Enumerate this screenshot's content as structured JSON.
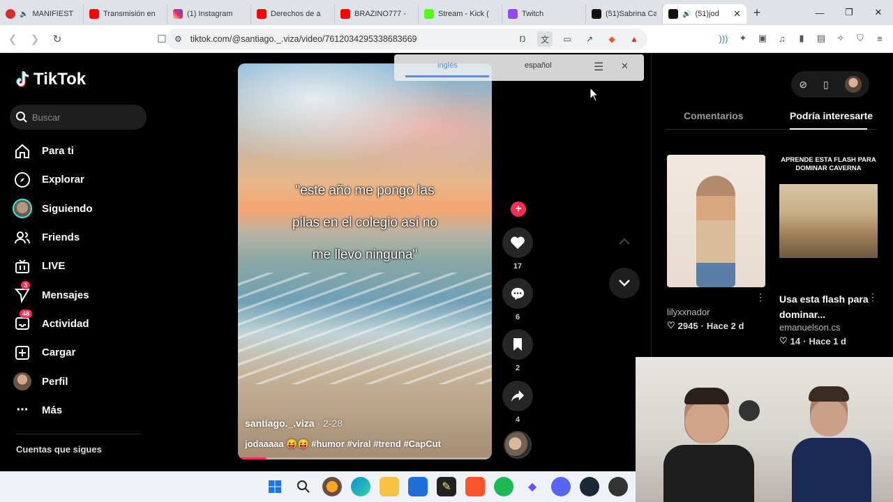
{
  "browser": {
    "tabs": [
      {
        "label": "MANIFIEST",
        "favicon": "#d32f2f"
      },
      {
        "label": "Transmisión en",
        "favicon": "#ff0000"
      },
      {
        "label": "(1) Instagram",
        "favicon": "#d6249f"
      },
      {
        "label": "Derechos de a",
        "favicon": "#ff0000"
      },
      {
        "label": "BRAZINO777 -",
        "favicon": "#ff0000"
      },
      {
        "label": "Stream - Kick (",
        "favicon": "#53fc18"
      },
      {
        "label": "Twitch",
        "favicon": "#9146ff"
      },
      {
        "label": "(51)Sabrina Ca",
        "favicon": "#111111"
      },
      {
        "label": "(51)jod",
        "favicon": "#111111"
      }
    ],
    "url": "tiktok.com/@santiago._.viza/video/7612034295338683669"
  },
  "translate_bar": {
    "options": [
      "inglés",
      "español"
    ]
  },
  "tiktok": {
    "logo_text": "TikTok",
    "search_placeholder": "Buscar",
    "nav": [
      {
        "label": "Para ti",
        "icon": "home-icon"
      },
      {
        "label": "Explorar",
        "icon": "compass-icon"
      },
      {
        "label": "Siguiendo",
        "icon": "following-avatar-icon"
      },
      {
        "label": "Friends",
        "icon": "friends-icon"
      },
      {
        "label": "LIVE",
        "icon": "live-icon"
      },
      {
        "label": "Mensajes",
        "icon": "send-icon",
        "badge": "3"
      },
      {
        "label": "Actividad",
        "icon": "inbox-icon",
        "badge": "48"
      },
      {
        "label": "Cargar",
        "icon": "upload-icon"
      },
      {
        "label": "Perfil",
        "icon": "profile-avatar-icon"
      },
      {
        "label": "Más",
        "icon": "more-icon"
      }
    ],
    "following_header": "Cuentas que sigues"
  },
  "video": {
    "caption_lines": [
      "\"este año me pongo las",
      "pilas en el colegio así no",
      "me llevo ninguna\""
    ],
    "author": "santiago._.viza",
    "date": "2-28",
    "description": "jodaaaaa 😝😝 #humor #viral #trend #CapCut",
    "progress": 0.11
  },
  "actions": {
    "likes": "17",
    "comments": "6",
    "saves": "2",
    "shares": "4"
  },
  "right_panel": {
    "tabs": [
      "Comentarios",
      "Podría interesarte"
    ],
    "cards": [
      {
        "author": "lilyxxnador",
        "likes": "2945",
        "ago": "Hace 2 d",
        "title": ""
      },
      {
        "thumb_title": "APRENDE ESTA FLASH PARA DOMINAR CAVERNA",
        "title": "Usa esta flash para dominar...",
        "author": "emanuelson.cs",
        "likes": "14",
        "ago": "Hace 1 d"
      }
    ]
  },
  "colors": {
    "accent": "#fe2c55",
    "bg": "#000000"
  }
}
